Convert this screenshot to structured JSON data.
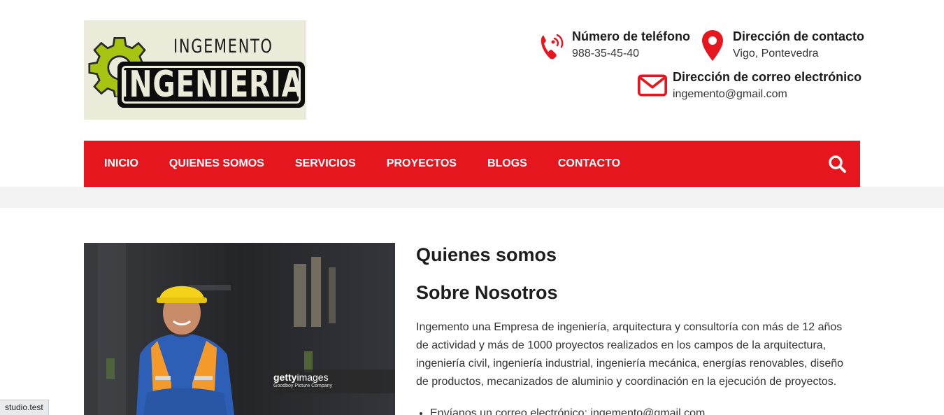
{
  "logo": {
    "top_text": "INGEMENTO",
    "main_text": "INGENIERIA",
    "gear_color": "#a6c411"
  },
  "contact": {
    "phone": {
      "title": "Número de teléfono",
      "value": "988-35-45-40",
      "icon": "phone-icon"
    },
    "address": {
      "title": "Dirección de contacto",
      "value": "Vigo, Pontevedra",
      "icon": "map-pin-icon"
    },
    "email": {
      "title": "Dirección de correo electrónico",
      "value": "ingemento@gmail.com",
      "icon": "envelope-icon"
    }
  },
  "nav": {
    "items": [
      {
        "label": "INICIO"
      },
      {
        "label": "QUIENES SOMOS"
      },
      {
        "label": "SERVICIOS"
      },
      {
        "label": "PROYECTOS"
      },
      {
        "label": "BLOGS"
      },
      {
        "label": "CONTACTO"
      }
    ],
    "search_icon": "search-icon"
  },
  "photo": {
    "watermark_brand_bold": "getty",
    "watermark_brand_thin": "images",
    "watermark_credit": "Goodboy Picture Company"
  },
  "about": {
    "heading": "Quienes somos",
    "subheading": "Sobre Nosotros",
    "body": "Ingemento una Empresa de ingeniería, arquitectura y consultoría con más de 12 años de actividad y más de 1000 proyectos realizados en los campos de la arquitectura, ingeniería civil, ingeniería industrial, ingeniería mecánica, energías renovables, diseño de productos, mecanizados de aluminio y coordinación en la ejecución de proyectos.",
    "bullets": [
      "Envíanos un correo electrónico: ingemento@gmail.com"
    ]
  },
  "status_bar": {
    "text": "studio.test"
  },
  "colors": {
    "accent_red": "#e5161d",
    "gray_band": "#f3f3f3",
    "text_dark": "#1d1d1d"
  }
}
